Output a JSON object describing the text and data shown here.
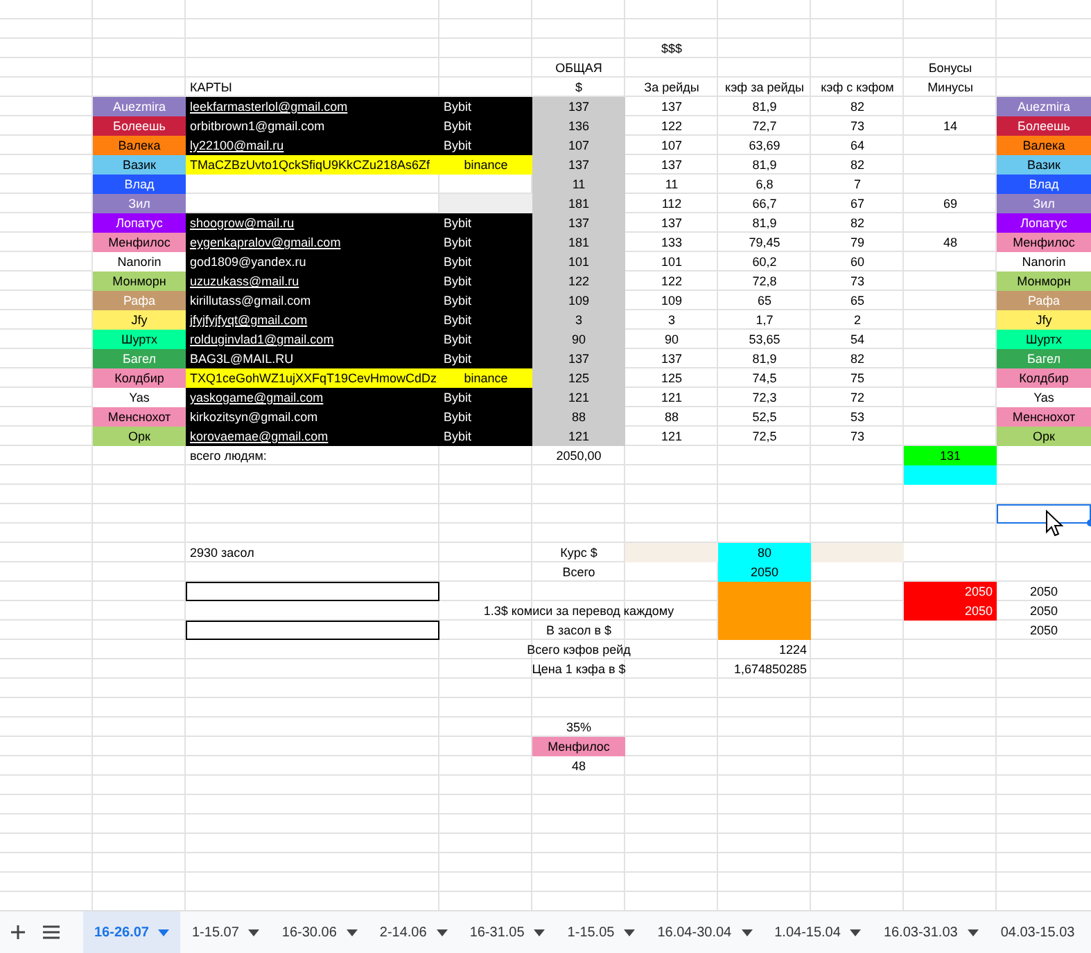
{
  "header": {
    "top": "$$$",
    "total": "ОБЩАЯ",
    "total_unit": "$",
    "cards": "КАРТЫ",
    "raids": "За рейды",
    "kef_raids": "кэф за рейды",
    "kef_bonus": "кэф с кэфом",
    "bonus": "Бонусы",
    "minus": "Минусы"
  },
  "players": [
    {
      "name": "Auezmira",
      "color": "#8e7cc3",
      "card": "leekfarmasterlol@gmail.com",
      "link": true,
      "exchange": "Bybit",
      "kind": "bybit",
      "total": "137",
      "raids": "137",
      "kef": "81,9",
      "kef_rounded": "82",
      "name_right": "Auezmira"
    },
    {
      "name": "Болеешь",
      "color": "#c9203f",
      "card": "orbitbrown1@gmail.com",
      "link": false,
      "exchange": "Bybit",
      "kind": "bybit",
      "total": "136",
      "raids": "122",
      "kef": "72,7",
      "kef_rounded": "73",
      "bonus": "14",
      "name_right": "Болеешь"
    },
    {
      "name": "Валека",
      "color": "#ff7f0e",
      "card": "ly22100@mail.ru",
      "link": true,
      "exchange": "Bybit",
      "kind": "bybit",
      "total": "107",
      "raids": "107",
      "kef": "63,69",
      "kef_rounded": "64",
      "name_right": "Валека"
    },
    {
      "name": "Вазик",
      "color": "#6bc8ef",
      "card": "TMaCZBzUvto1QckSfiqU9KkCZu218As6Zf",
      "link": false,
      "exchange": "binance",
      "kind": "binance",
      "total": "137",
      "raids": "137",
      "kef": "81,9",
      "kef_rounded": "82",
      "name_right": "Вазик"
    },
    {
      "name": "Влад",
      "color": "#2457ff",
      "kind": "none",
      "total": "11",
      "raids": "11",
      "kef": "6,8",
      "kef_rounded": "7",
      "name_right": "Влад"
    },
    {
      "name": "Зил",
      "color": "#8e7cc3",
      "kind": "none_grey",
      "total": "181",
      "raids": "112",
      "kef": "66,7",
      "kef_rounded": "67",
      "bonus": "69",
      "name_right": "Зил"
    },
    {
      "name": "Лопатус",
      "color": "#9900ff",
      "card": "shoogrow@mail.ru",
      "link": true,
      "exchange": "Bybit",
      "kind": "bybit",
      "total": "137",
      "raids": "137",
      "kef": "81,9",
      "kef_rounded": "82",
      "name_right": "Лопатус"
    },
    {
      "name": "Менфилос",
      "color": "#f18db2",
      "card": "eygenkapralov@gmail.com",
      "link": true,
      "exchange": "Bybit",
      "kind": "bybit",
      "total": "181",
      "raids": "133",
      "kef": "79,45",
      "kef_rounded": "79",
      "bonus": "48",
      "name_right": "Менфилос"
    },
    {
      "name": "Nanorin",
      "color": "#ffffff",
      "card": "god1809@yandex.ru",
      "link": false,
      "exchange": "Bybit",
      "kind": "bybit",
      "total": "101",
      "raids": "101",
      "kef": "60,2",
      "kef_rounded": "60",
      "name_right": "Nanorin"
    },
    {
      "name": "Монморн",
      "color": "#a9d46f",
      "card": "uzuzukass@mail.ru",
      "link": true,
      "exchange": "Bybit",
      "kind": "bybit",
      "total": "122",
      "raids": "122",
      "kef": "72,8",
      "kef_rounded": "73",
      "name_right": "Монморн"
    },
    {
      "name": "Рафа",
      "color": "#c49a6c",
      "card": "kirillutass@gmail.com",
      "link": false,
      "exchange": "Bybit",
      "kind": "bybit",
      "total": "109",
      "raids": "109",
      "kef": "65",
      "kef_rounded": "65",
      "name_right": "Рафа"
    },
    {
      "name": "Jfy",
      "color": "#ffee66",
      "card": "jfyjfyjfyqt@gmail.com",
      "link": true,
      "exchange": "Bybit",
      "kind": "bybit",
      "total": "3",
      "raids": "3",
      "kef": "1,7",
      "kef_rounded": "2",
      "name_right": "Jfy"
    },
    {
      "name": "Шуртх",
      "color": "#00ff99",
      "card": "rolduginvlad1@gmail.com",
      "link": true,
      "exchange": "Bybit",
      "kind": "bybit",
      "total": "90",
      "raids": "90",
      "kef": "53,65",
      "kef_rounded": "54",
      "name_right": "Шуртх"
    },
    {
      "name": "Багел",
      "color": "#34a853",
      "card": "BAG3L@MAIL.RU",
      "link": false,
      "exchange": "Bybit",
      "kind": "bybit",
      "total": "137",
      "raids": "137",
      "kef": "81,9",
      "kef_rounded": "82",
      "name_right": "Багел"
    },
    {
      "name": "Колдбир",
      "color": "#f18db2",
      "card": "TXQ1ceGohWZ1ujXXFqT19CevHmowCdDz",
      "link": false,
      "exchange": "binance",
      "kind": "binance",
      "total": "125",
      "raids": "125",
      "kef": "74,5",
      "kef_rounded": "75",
      "name_right": "Колдбир"
    },
    {
      "name": "Yas",
      "color": "#ffffff",
      "card": "yaskogame@gmail.com",
      "link": true,
      "exchange": "Bybit",
      "kind": "bybit",
      "total": "121",
      "raids": "121",
      "kef": "72,3",
      "kef_rounded": "72",
      "name_right": "Yas"
    },
    {
      "name": "Менснохот",
      "color": "#f18db2",
      "card": "kirkozitsyn@gmail.com",
      "link": false,
      "exchange": "Bybit",
      "kind": "bybit",
      "total": "88",
      "raids": "88",
      "kef": "52,5",
      "kef_rounded": "53",
      "name_right": "Менснохот"
    },
    {
      "name": "Орк",
      "color": "#a9d46f",
      "card": "korovaemae@gmail.com",
      "link": true,
      "exchange": "Bybit",
      "kind": "bybit",
      "total": "121",
      "raids": "121",
      "kef": "72,5",
      "kef_rounded": "73",
      "name_right": "Орк"
    }
  ],
  "summary": {
    "people_total": {
      "label": "всего людям:",
      "value": "2050,00"
    },
    "bonus_total": "131",
    "selected_cell": {
      "selected": true
    },
    "zasol": "2930 засол",
    "rate": {
      "label": "Курс $",
      "value": "80"
    },
    "total": {
      "label": "Всего",
      "value": "2050"
    },
    "commission": {
      "label": "1.3$ комиси за перевод каждому"
    },
    "in_zasol": {
      "label": "В засол в $"
    },
    "red_values": [
      "2050",
      "2050"
    ],
    "right_values": [
      "2050",
      "2050",
      "2050"
    ],
    "kef_total": {
      "label": "Всего кэфов  рейд",
      "value": "1224"
    },
    "kef_price": {
      "label": "Цена 1 кэфа в $",
      "value": "1,674850285"
    },
    "share": {
      "percent": "35%",
      "name": "Менфилос",
      "color": "#f18db2",
      "value": "48"
    }
  },
  "tabs": [
    {
      "label": "16-26.07",
      "selected": true,
      "caret": true
    },
    {
      "label": "1-15.07",
      "selected": false,
      "caret": true
    },
    {
      "label": "16-30.06",
      "selected": false,
      "caret": true
    },
    {
      "label": "2-14.06",
      "selected": false,
      "caret": true
    },
    {
      "label": "16-31.05",
      "selected": false,
      "caret": true
    },
    {
      "label": "1-15.05",
      "selected": false,
      "caret": true
    },
    {
      "label": "16.04-30.04",
      "selected": false,
      "caret": true
    },
    {
      "label": "1.04-15.04",
      "selected": false,
      "caret": true
    },
    {
      "label": "16.03-31.03",
      "selected": false,
      "caret": true
    },
    {
      "label": "04.03-15.03",
      "selected": false,
      "caret": false
    }
  ]
}
